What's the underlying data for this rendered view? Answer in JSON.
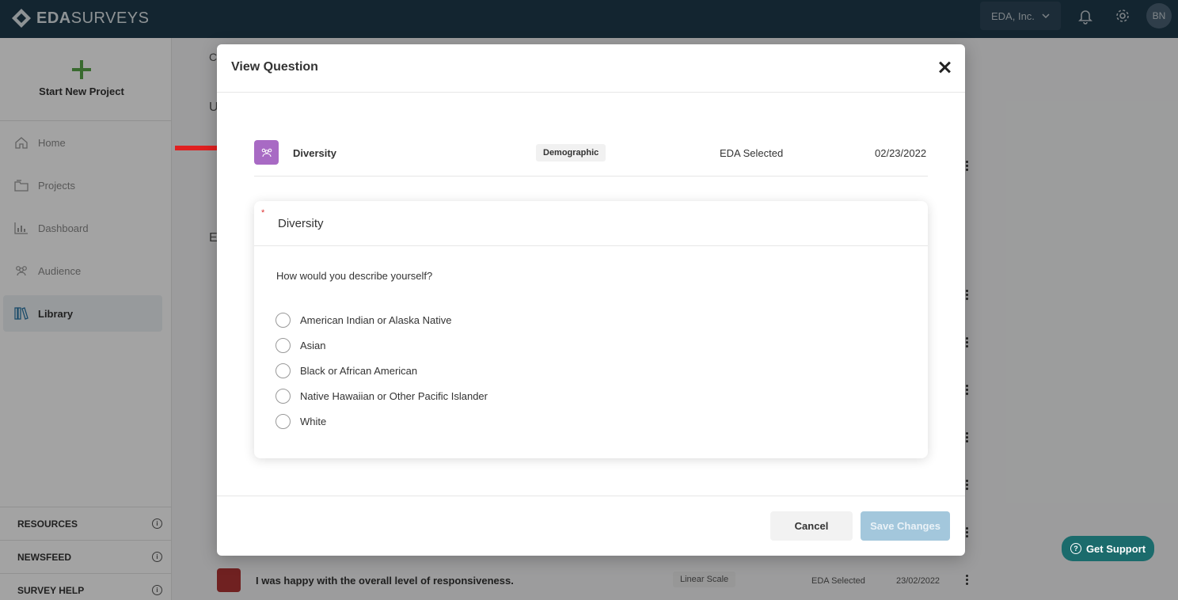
{
  "header": {
    "brand_prefix": "EDA",
    "brand_suffix": "SURVEYS",
    "org": "EDA, Inc.",
    "user_initials": "BN"
  },
  "sidebar": {
    "new_project": "Start New Project",
    "items": [
      {
        "label": "Home",
        "icon": "home-icon"
      },
      {
        "label": "Projects",
        "icon": "folder-icon"
      },
      {
        "label": "Dashboard",
        "icon": "chart-icon"
      },
      {
        "label": "Audience",
        "icon": "people-icon"
      },
      {
        "label": "Library",
        "icon": "library-icon",
        "active": true
      }
    ],
    "bottom": [
      {
        "label": "RESOURCES"
      },
      {
        "label": "NEWSFEED"
      },
      {
        "label": "SURVEY HELP"
      }
    ]
  },
  "background": {
    "c_text": "C",
    "u_text": "U",
    "e_text": "E",
    "last_row": {
      "text": "I was happy with the overall level of responsiveness.",
      "type": "Linear Scale",
      "selected": "EDA Selected",
      "date": "23/02/2022"
    }
  },
  "modal": {
    "title": "View Question",
    "question": {
      "name": "Diversity",
      "category": "Demographic",
      "selection": "EDA Selected",
      "date": "02/23/2022"
    },
    "preview": {
      "required_mark": "*",
      "title": "Diversity",
      "prompt": "How would you describe yourself?",
      "options": [
        "American Indian or Alaska Native",
        "Asian",
        "Black or African American",
        "Native Hawaiian or Other Pacific Islander",
        "White"
      ]
    },
    "cancel_label": "Cancel",
    "save_label": "Save Changes"
  },
  "support": {
    "label": "Get Support"
  },
  "colors": {
    "topbar": "#1f3a4c",
    "accent_green": "#5aa64a",
    "question_icon": "#a86ac4",
    "save_button": "#a3c7dc",
    "support": "#1b6b6c",
    "annotation_arrow": "#e02020"
  }
}
